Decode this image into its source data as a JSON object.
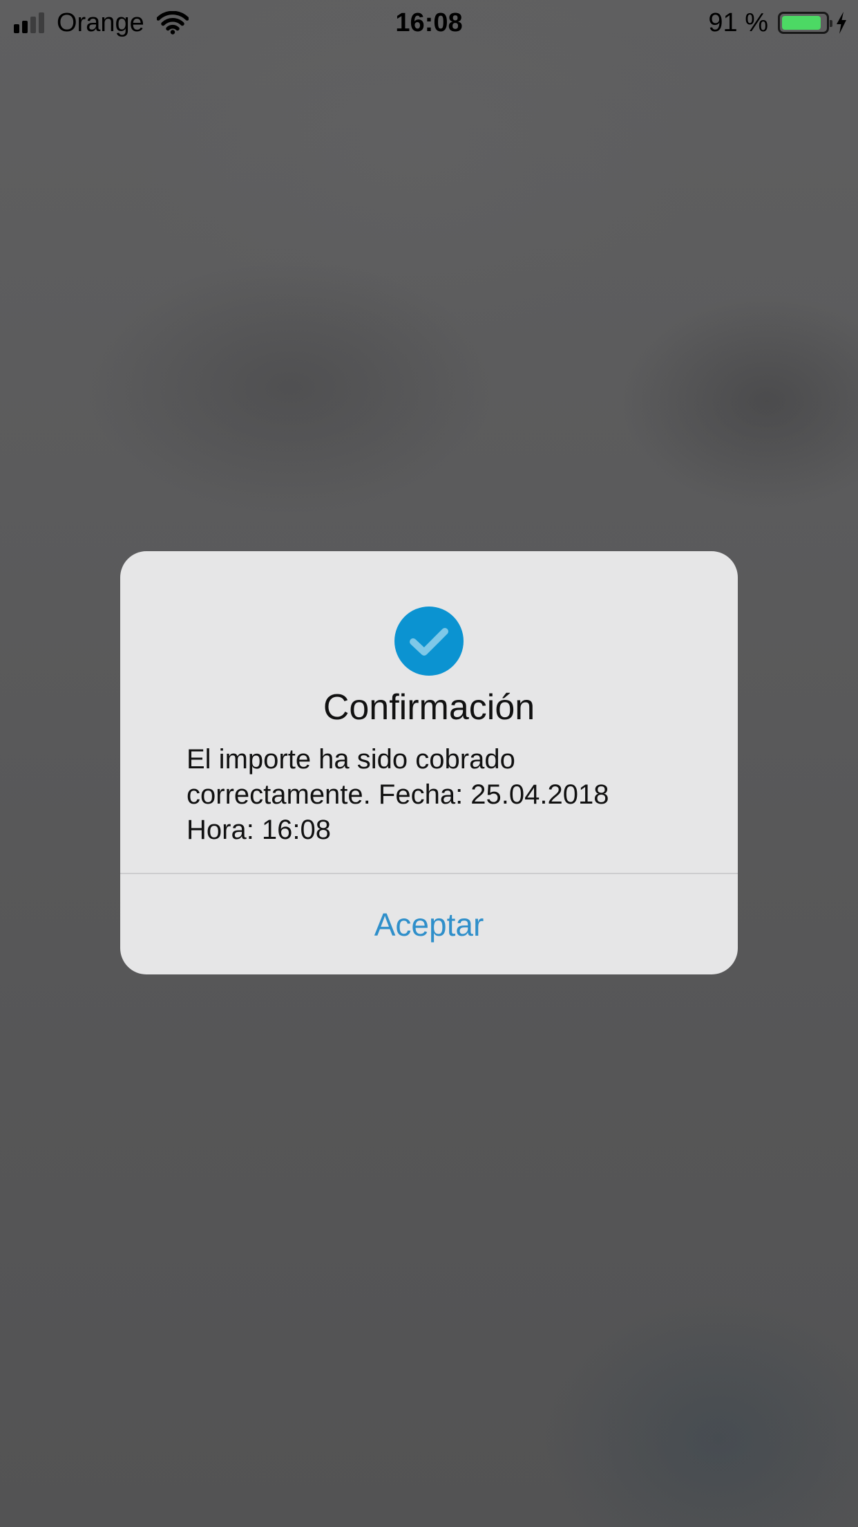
{
  "status_bar": {
    "carrier": "Orange",
    "time": "16:08",
    "battery_percent_label": "91 %",
    "battery_level": 0.91,
    "signal_bars_filled": 2,
    "signal_bars_total": 4
  },
  "alert": {
    "icon": "checkmark-circle-icon",
    "title": "Confirmación",
    "message_lines": [
      "El importe ha sido cobrado",
      "correctamente. Fecha: 25.04.2018",
      "Hora: 16:08"
    ],
    "button_label": "Aceptar"
  },
  "colors": {
    "accent": "#0b93d1",
    "button_text": "#2f8fca",
    "battery": "#4cd964",
    "alert_background": "#e6e6e7",
    "backdrop": "#575758"
  }
}
